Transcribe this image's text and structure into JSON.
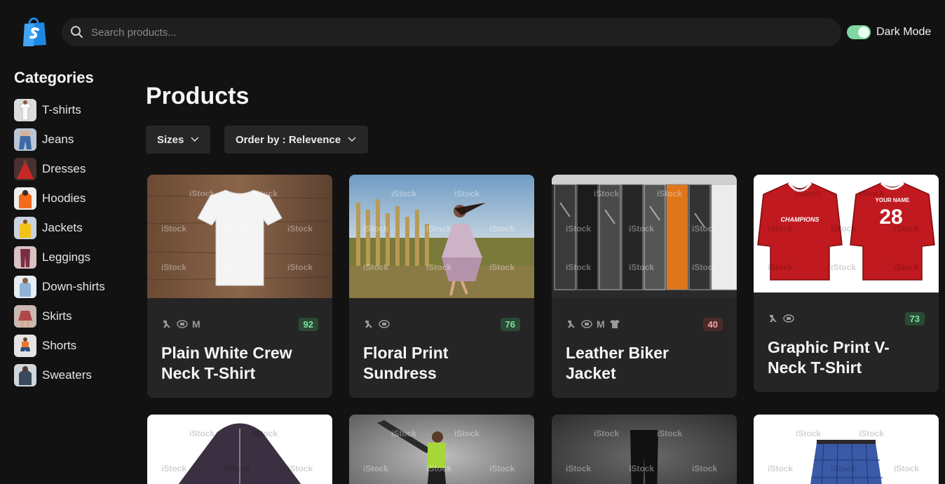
{
  "header": {
    "search_placeholder": "Search products...",
    "dark_mode_label": "Dark Mode",
    "dark_mode_on": true
  },
  "sidebar": {
    "title": "Categories",
    "items": [
      {
        "label": "T-shirts"
      },
      {
        "label": "Jeans"
      },
      {
        "label": "Dresses"
      },
      {
        "label": "Hoodies"
      },
      {
        "label": "Jackets"
      },
      {
        "label": "Leggings"
      },
      {
        "label": "Down-shirts"
      },
      {
        "label": "Skirts"
      },
      {
        "label": "Shorts"
      },
      {
        "label": "Sweaters"
      }
    ]
  },
  "main": {
    "title": "Products",
    "filters": {
      "sizes_label": "Sizes",
      "order_label": "Order by : Relevence"
    },
    "products": [
      {
        "name": "Plain White Crew Neck T-Shirt",
        "stock": "92",
        "stock_status": "green",
        "size_letter": "M"
      },
      {
        "name": "Floral Print Sundress",
        "stock": "76",
        "stock_status": "green",
        "size_letter": ""
      },
      {
        "name": "Leather Biker Jacket",
        "stock": "40",
        "stock_status": "red",
        "size_letter": "M"
      },
      {
        "name": "Graphic Print V-Neck T-Shirt",
        "stock": "73",
        "stock_status": "green",
        "size_letter": ""
      }
    ],
    "jersey": {
      "team": "CHAMPIONS",
      "back_name": "YOUR NAME",
      "number": "28"
    },
    "watermark": "iStock"
  },
  "colors": {
    "background": "#121212",
    "card": "#252525",
    "accent_green": "#7fd7a3",
    "badge_green": "#7fe3a2",
    "badge_red": "#f3a5a5"
  }
}
